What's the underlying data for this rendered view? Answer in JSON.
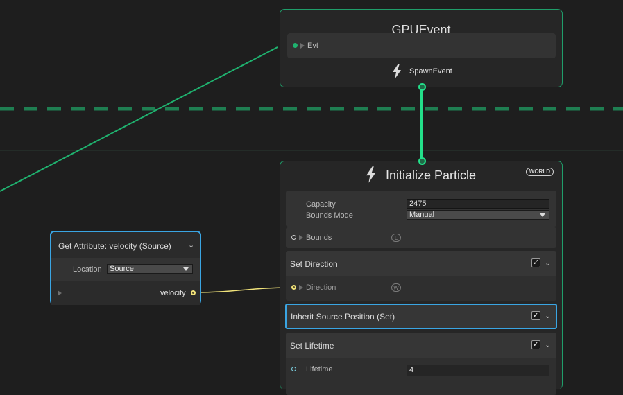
{
  "gpu_event": {
    "title": "GPUEvent",
    "input_slot_label": "Evt",
    "output_label": "SpawnEvent"
  },
  "initialize": {
    "title": "Initialize Particle",
    "space_badge": "WORLD",
    "capacity_label": "Capacity",
    "capacity_value": "2475",
    "bounds_mode_label": "Bounds Mode",
    "bounds_mode_value": "Manual",
    "bounds_label": "Bounds",
    "bounds_space": "L",
    "blocks": [
      {
        "title": "Set Direction",
        "enabled": true,
        "slot_label": "Direction",
        "slot_space": "W"
      },
      {
        "title": "Inherit Source Position (Set)",
        "enabled": true
      },
      {
        "title": "Set Lifetime",
        "enabled": true,
        "slot_label": "Lifetime",
        "slot_value": "4"
      }
    ]
  },
  "get_attribute": {
    "title": "Get Attribute: velocity (Source)",
    "location_label": "Location",
    "location_value": "Source",
    "output_label": "velocity"
  },
  "colors": {
    "background": "#1e1e1e",
    "node_border": "#1f9e6a",
    "flow_link": "#23e08a",
    "selected_border": "#3aa5e3",
    "vector_port": "#f0e27a"
  }
}
